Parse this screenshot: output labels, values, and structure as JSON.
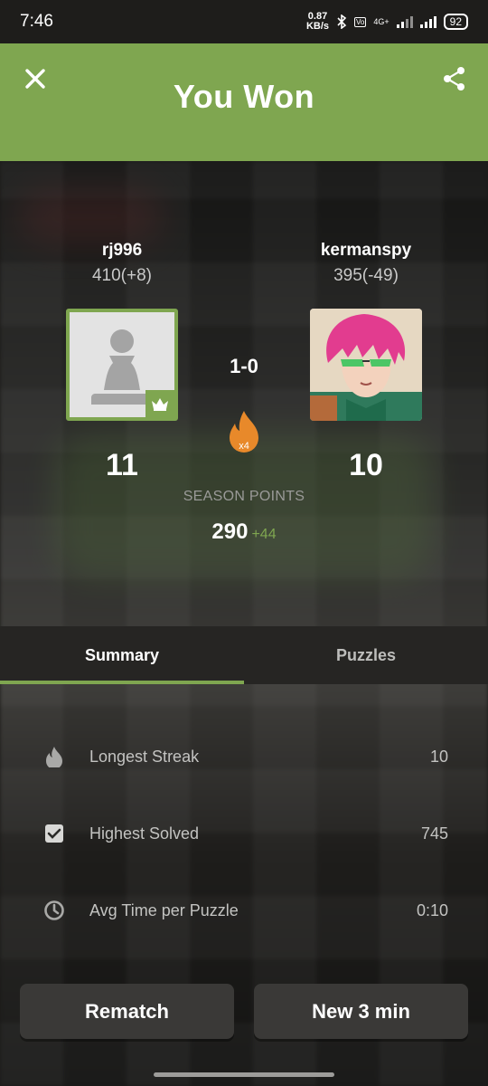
{
  "status_bar": {
    "time": "7:46",
    "speed_value": "0.87",
    "speed_unit": "KB/s",
    "network": "4G+",
    "battery": "92"
  },
  "header": {
    "title": "You Won",
    "close_icon": "close-icon",
    "share_icon": "share-icon",
    "color": "#7fa650"
  },
  "players": {
    "left": {
      "name": "rj996",
      "rating": "410(+8)",
      "points": "11",
      "avatar": "pawn-icon",
      "badge": "crown-icon"
    },
    "right": {
      "name": "kermanspy",
      "rating": "395(-49)",
      "points": "10",
      "avatar": "anime-character-avatar"
    }
  },
  "match": {
    "score": "1-0",
    "streak_multiplier": "x4",
    "streak_icon": "flame-icon"
  },
  "season": {
    "label": "SEASON POINTS",
    "value": "290",
    "delta": "+44"
  },
  "tabs": [
    {
      "label": "Summary",
      "active": true
    },
    {
      "label": "Puzzles",
      "active": false
    }
  ],
  "stats": [
    {
      "icon": "flame-icon",
      "label": "Longest Streak",
      "value": "10"
    },
    {
      "icon": "checkbox-icon",
      "label": "Highest Solved",
      "value": "745"
    },
    {
      "icon": "clock-icon",
      "label": "Avg Time per Puzzle",
      "value": "0:10"
    }
  ],
  "buttons": {
    "rematch": "Rematch",
    "new_game": "New 3 min"
  }
}
